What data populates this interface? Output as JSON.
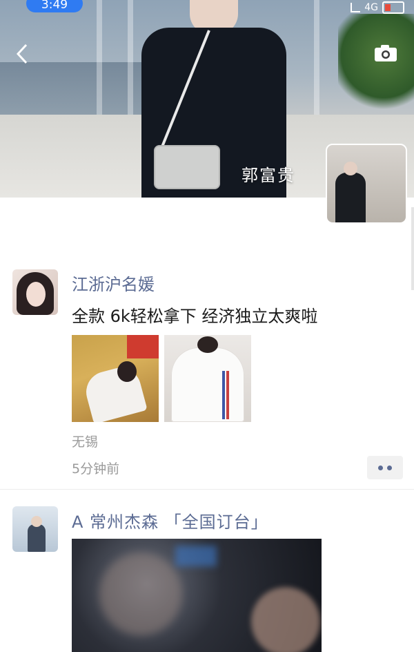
{
  "status_bar": {
    "time": "3:49",
    "network": "4G"
  },
  "header": {
    "owner_name": "郭富贵"
  },
  "icons": {
    "back": "chevron-left-icon",
    "camera": "camera-icon",
    "more": "more-dots-icon"
  },
  "colors": {
    "nickname": "#5b6b93",
    "status_time_bg": "#2f7bf2",
    "meta_text": "#9a9a9a"
  },
  "moments": [
    {
      "nickname": "江浙沪名媛",
      "text": "全款 6k轻松拿下 经济独立太爽啦",
      "location": "无锡",
      "time_ago": "5分钟前",
      "photo_count": 2
    },
    {
      "nickname": "A 常州杰森 「全国订台」",
      "media": "video"
    }
  ]
}
